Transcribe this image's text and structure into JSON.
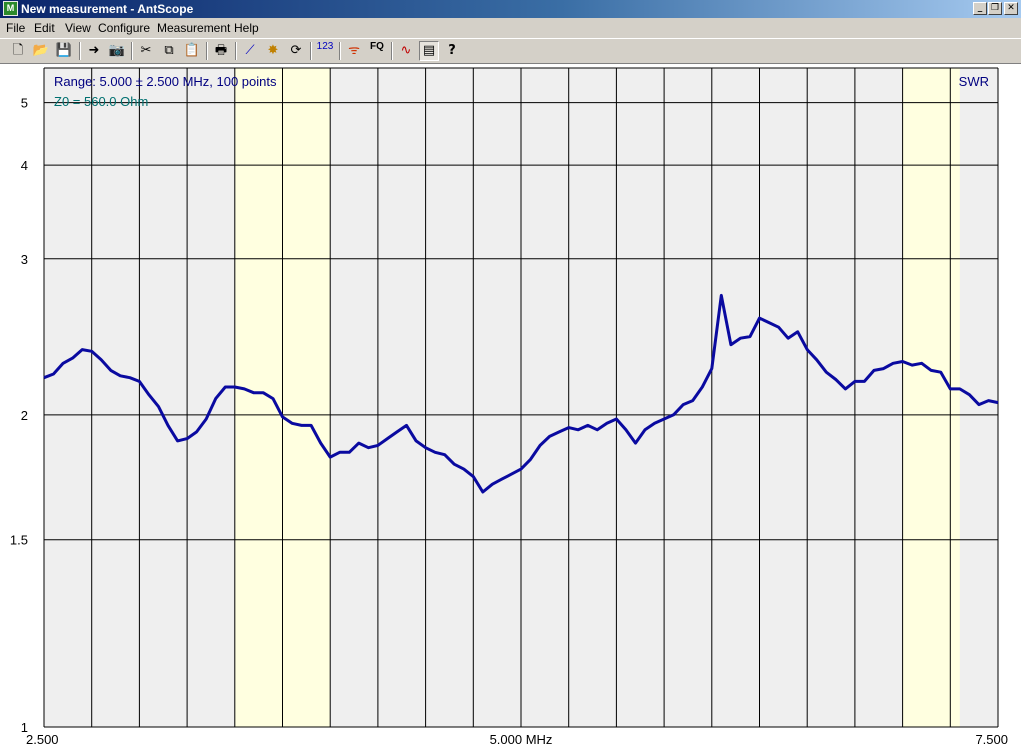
{
  "window": {
    "title": "New measurement - AntScope",
    "app_icon_label": "M",
    "controls": [
      "_",
      "❐",
      "✕"
    ]
  },
  "menu": [
    "File",
    "Edit",
    "View",
    "Configure",
    "Measurement",
    "Help"
  ],
  "toolbar": {
    "buttons": [
      {
        "name": "new-icon",
        "glyph": "🗋"
      },
      {
        "name": "open-folder-icon",
        "glyph": "📂"
      },
      {
        "name": "save-icon",
        "glyph": "💾"
      },
      {
        "name": "export-icon",
        "glyph": "➜"
      },
      {
        "name": "camera-icon",
        "glyph": "📷"
      },
      {
        "name": "cut-icon",
        "glyph": "✂"
      },
      {
        "name": "copy-icon",
        "glyph": "⧉"
      },
      {
        "name": "paste-icon",
        "glyph": "📋"
      },
      {
        "name": "print-icon",
        "glyph": "🖶"
      },
      {
        "name": "chart-icon",
        "glyph": "⟋"
      },
      {
        "name": "burst-icon",
        "glyph": "✸"
      },
      {
        "name": "refresh-icon",
        "glyph": "⟳"
      },
      {
        "name": "numbers-icon",
        "glyph": "123"
      },
      {
        "name": "antenna-icon",
        "glyph": "ᯤ"
      },
      {
        "name": "fq-icon",
        "glyph": "FQ"
      },
      {
        "name": "curves-icon",
        "glyph": "∿"
      },
      {
        "name": "list-icon",
        "glyph": "▤"
      },
      {
        "name": "help-icon",
        "glyph": "?"
      }
    ]
  },
  "plot": {
    "range_text": "Range: 5.000 ± 2.500 MHz, 100 points",
    "z0_text": "Z0 = 560.0 Ohm",
    "mode_label": "SWR",
    "colors": {
      "background": "#efefef",
      "band": "#ffffe0",
      "grid": "#000000",
      "trace": "#0a0aa0",
      "range_text": "#000080",
      "z0_text": "#007070"
    }
  },
  "chart_data": {
    "type": "line",
    "title": "",
    "xlabel": "MHz",
    "ylabel": "SWR",
    "xlim": [
      2.5,
      7.5
    ],
    "ylim": [
      1,
      5.75
    ],
    "x_tick_labels": [
      "2.500",
      "5.000 MHz",
      "7.500"
    ],
    "y_ticks": [
      1,
      1.5,
      2,
      3,
      4,
      5
    ],
    "y_tick_labels": [
      "1",
      "1.5",
      "2",
      "3",
      "4",
      "5"
    ],
    "y_scale": "reflection-coefficient",
    "grid": true,
    "highlight_bands_mhz": [
      [
        3.5,
        4.0
      ],
      [
        7.0,
        7.3
      ]
    ],
    "series": [
      {
        "x": [
          2.5,
          2.55,
          2.6,
          2.65,
          2.7,
          2.75,
          2.8,
          2.85,
          2.9,
          2.95,
          3.0,
          3.05,
          3.1,
          3.15,
          3.2,
          3.25,
          3.3,
          3.35,
          3.4,
          3.45,
          3.5,
          3.55,
          3.6,
          3.65,
          3.7,
          3.75,
          3.8,
          3.85,
          3.9,
          3.95,
          4.0,
          4.05,
          4.1,
          4.15,
          4.2,
          4.25,
          4.3,
          4.35,
          4.4,
          4.45,
          4.5,
          4.55,
          4.6,
          4.65,
          4.7,
          4.75,
          4.8,
          4.85,
          4.9,
          4.95,
          5.0,
          5.05,
          5.1,
          5.15,
          5.2,
          5.25,
          5.3,
          5.35,
          5.4,
          5.45,
          5.5,
          5.55,
          5.6,
          5.65,
          5.7,
          5.75,
          5.8,
          5.85,
          5.9,
          5.95,
          6.0,
          6.05,
          6.1,
          6.15,
          6.2,
          6.25,
          6.3,
          6.35,
          6.4,
          6.45,
          6.5,
          6.55,
          6.6,
          6.65,
          6.7,
          6.75,
          6.8,
          6.85,
          6.9,
          6.95,
          7.0,
          7.05,
          7.1,
          7.15,
          7.2,
          7.25,
          7.3,
          7.35,
          7.4,
          7.45,
          7.5
        ],
        "y": [
          2.19,
          2.21,
          2.27,
          2.3,
          2.35,
          2.34,
          2.29,
          2.23,
          2.2,
          2.19,
          2.17,
          2.1,
          2.04,
          1.95,
          1.88,
          1.89,
          1.92,
          1.98,
          2.08,
          2.14,
          2.14,
          2.13,
          2.11,
          2.11,
          2.08,
          1.99,
          1.96,
          1.95,
          1.95,
          1.87,
          1.81,
          1.83,
          1.83,
          1.87,
          1.85,
          1.86,
          1.89,
          1.92,
          1.95,
          1.88,
          1.85,
          1.83,
          1.82,
          1.78,
          1.76,
          1.73,
          1.67,
          1.7,
          1.72,
          1.74,
          1.76,
          1.8,
          1.86,
          1.9,
          1.92,
          1.94,
          1.93,
          1.95,
          1.93,
          1.96,
          1.98,
          1.93,
          1.87,
          1.93,
          1.96,
          1.98,
          2.0,
          2.05,
          2.07,
          2.14,
          2.24,
          2.71,
          2.38,
          2.42,
          2.43,
          2.55,
          2.52,
          2.49,
          2.42,
          2.46,
          2.35,
          2.29,
          2.22,
          2.18,
          2.13,
          2.17,
          2.17,
          2.23,
          2.24,
          2.27,
          2.28,
          2.26,
          2.27,
          2.23,
          2.22,
          2.13,
          2.13,
          2.1,
          2.05,
          2.07,
          2.06
        ]
      }
    ]
  }
}
